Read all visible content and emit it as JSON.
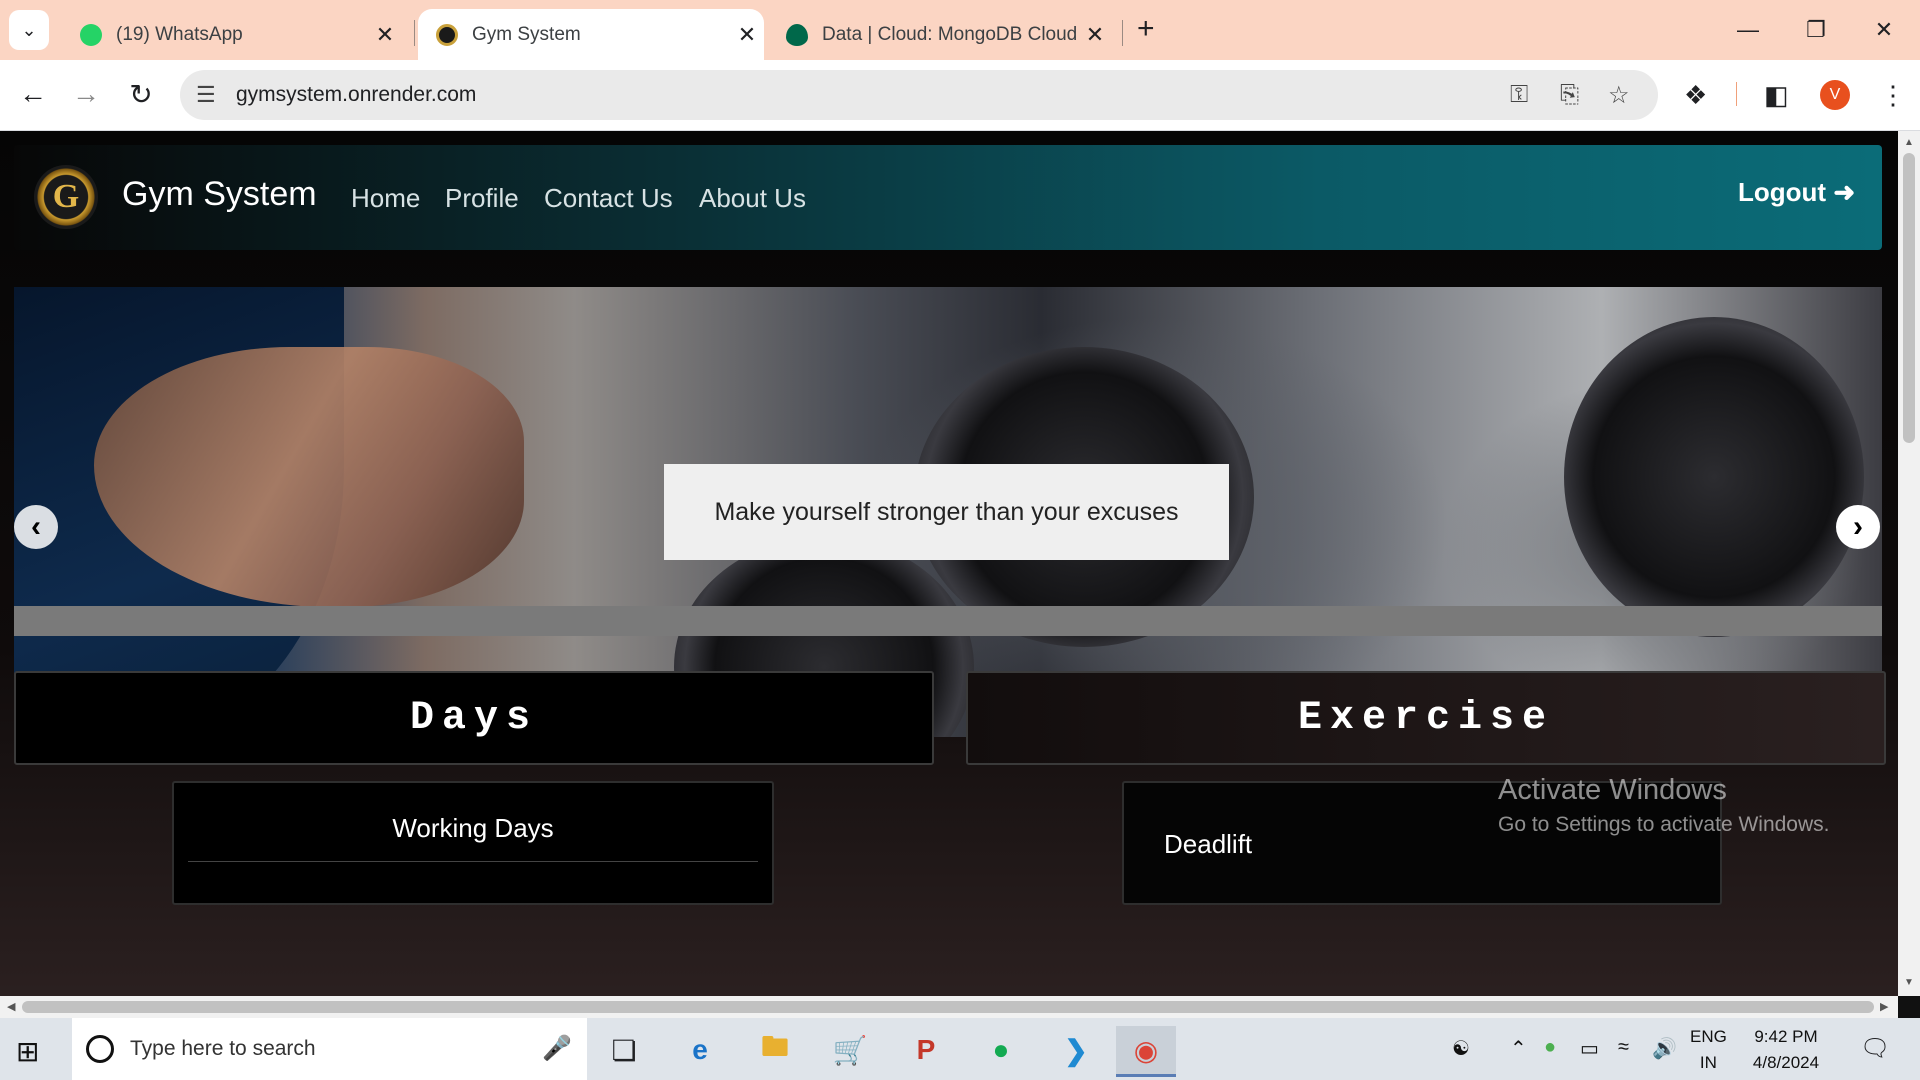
{
  "browser": {
    "tabs": [
      {
        "title": "(19) WhatsApp",
        "active": false,
        "favicon_color": "#25d366"
      },
      {
        "title": "Gym System",
        "active": true,
        "favicon_color": "#c9a13b"
      },
      {
        "title": "Data | Cloud: MongoDB Cloud",
        "active": false,
        "favicon_color": "#00684a"
      }
    ],
    "url": "gymsystem.onrender.com",
    "profile_initial": "V"
  },
  "site": {
    "logo_letter": "G",
    "brand": "Gym System",
    "nav": [
      "Home",
      "Profile",
      "Contact Us",
      "About Us"
    ],
    "logout": "Logout"
  },
  "carousel": {
    "caption": "Make yourself stronger than your excuses"
  },
  "sections": {
    "days_title": "Days",
    "exercise_title": "Exercise",
    "working_days": "Working Days",
    "exercise_item": "Deadlift"
  },
  "watermark": {
    "line1": "Activate Windows",
    "line2": "Go to Settings to activate Windows."
  },
  "taskbar": {
    "search_placeholder": "Type here to search",
    "lang_line1": "ENG",
    "lang_line2": "IN",
    "time": "9:42 PM",
    "date": "4/8/2024"
  },
  "colors": {
    "navbar_accent": "#0b6c78",
    "tabbar_bg": "#fbd5c3",
    "profile_badge": "#e8501e"
  }
}
